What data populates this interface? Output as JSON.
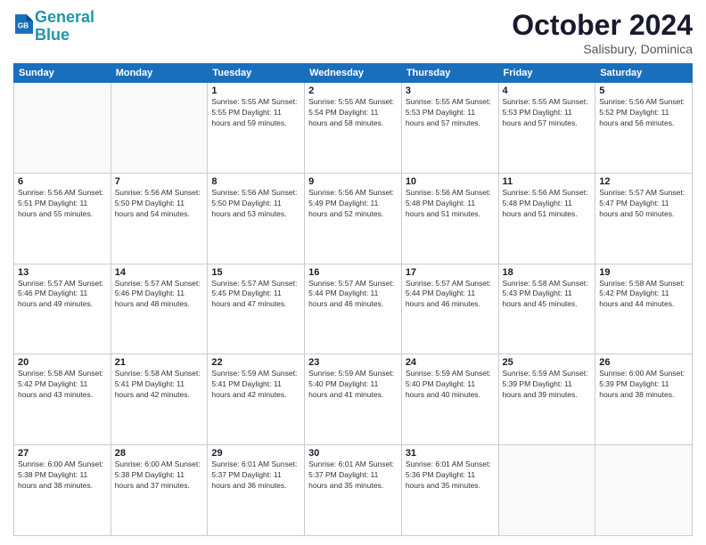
{
  "header": {
    "logo_line1": "General",
    "logo_line2": "Blue",
    "month": "October 2024",
    "location": "Salisbury, Dominica"
  },
  "days_of_week": [
    "Sunday",
    "Monday",
    "Tuesday",
    "Wednesday",
    "Thursday",
    "Friday",
    "Saturday"
  ],
  "weeks": [
    [
      {
        "day": "",
        "detail": ""
      },
      {
        "day": "",
        "detail": ""
      },
      {
        "day": "1",
        "detail": "Sunrise: 5:55 AM\nSunset: 5:55 PM\nDaylight: 11 hours and 59 minutes."
      },
      {
        "day": "2",
        "detail": "Sunrise: 5:55 AM\nSunset: 5:54 PM\nDaylight: 11 hours and 58 minutes."
      },
      {
        "day": "3",
        "detail": "Sunrise: 5:55 AM\nSunset: 5:53 PM\nDaylight: 11 hours and 57 minutes."
      },
      {
        "day": "4",
        "detail": "Sunrise: 5:55 AM\nSunset: 5:53 PM\nDaylight: 11 hours and 57 minutes."
      },
      {
        "day": "5",
        "detail": "Sunrise: 5:56 AM\nSunset: 5:52 PM\nDaylight: 11 hours and 56 minutes."
      }
    ],
    [
      {
        "day": "6",
        "detail": "Sunrise: 5:56 AM\nSunset: 5:51 PM\nDaylight: 11 hours and 55 minutes."
      },
      {
        "day": "7",
        "detail": "Sunrise: 5:56 AM\nSunset: 5:50 PM\nDaylight: 11 hours and 54 minutes."
      },
      {
        "day": "8",
        "detail": "Sunrise: 5:56 AM\nSunset: 5:50 PM\nDaylight: 11 hours and 53 minutes."
      },
      {
        "day": "9",
        "detail": "Sunrise: 5:56 AM\nSunset: 5:49 PM\nDaylight: 11 hours and 52 minutes."
      },
      {
        "day": "10",
        "detail": "Sunrise: 5:56 AM\nSunset: 5:48 PM\nDaylight: 11 hours and 51 minutes."
      },
      {
        "day": "11",
        "detail": "Sunrise: 5:56 AM\nSunset: 5:48 PM\nDaylight: 11 hours and 51 minutes."
      },
      {
        "day": "12",
        "detail": "Sunrise: 5:57 AM\nSunset: 5:47 PM\nDaylight: 11 hours and 50 minutes."
      }
    ],
    [
      {
        "day": "13",
        "detail": "Sunrise: 5:57 AM\nSunset: 5:46 PM\nDaylight: 11 hours and 49 minutes."
      },
      {
        "day": "14",
        "detail": "Sunrise: 5:57 AM\nSunset: 5:46 PM\nDaylight: 11 hours and 48 minutes."
      },
      {
        "day": "15",
        "detail": "Sunrise: 5:57 AM\nSunset: 5:45 PM\nDaylight: 11 hours and 47 minutes."
      },
      {
        "day": "16",
        "detail": "Sunrise: 5:57 AM\nSunset: 5:44 PM\nDaylight: 11 hours and 46 minutes."
      },
      {
        "day": "17",
        "detail": "Sunrise: 5:57 AM\nSunset: 5:44 PM\nDaylight: 11 hours and 46 minutes."
      },
      {
        "day": "18",
        "detail": "Sunrise: 5:58 AM\nSunset: 5:43 PM\nDaylight: 11 hours and 45 minutes."
      },
      {
        "day": "19",
        "detail": "Sunrise: 5:58 AM\nSunset: 5:42 PM\nDaylight: 11 hours and 44 minutes."
      }
    ],
    [
      {
        "day": "20",
        "detail": "Sunrise: 5:58 AM\nSunset: 5:42 PM\nDaylight: 11 hours and 43 minutes."
      },
      {
        "day": "21",
        "detail": "Sunrise: 5:58 AM\nSunset: 5:41 PM\nDaylight: 11 hours and 42 minutes."
      },
      {
        "day": "22",
        "detail": "Sunrise: 5:59 AM\nSunset: 5:41 PM\nDaylight: 11 hours and 42 minutes."
      },
      {
        "day": "23",
        "detail": "Sunrise: 5:59 AM\nSunset: 5:40 PM\nDaylight: 11 hours and 41 minutes."
      },
      {
        "day": "24",
        "detail": "Sunrise: 5:59 AM\nSunset: 5:40 PM\nDaylight: 11 hours and 40 minutes."
      },
      {
        "day": "25",
        "detail": "Sunrise: 5:59 AM\nSunset: 5:39 PM\nDaylight: 11 hours and 39 minutes."
      },
      {
        "day": "26",
        "detail": "Sunrise: 6:00 AM\nSunset: 5:39 PM\nDaylight: 11 hours and 38 minutes."
      }
    ],
    [
      {
        "day": "27",
        "detail": "Sunrise: 6:00 AM\nSunset: 5:38 PM\nDaylight: 11 hours and 38 minutes."
      },
      {
        "day": "28",
        "detail": "Sunrise: 6:00 AM\nSunset: 5:38 PM\nDaylight: 11 hours and 37 minutes."
      },
      {
        "day": "29",
        "detail": "Sunrise: 6:01 AM\nSunset: 5:37 PM\nDaylight: 11 hours and 36 minutes."
      },
      {
        "day": "30",
        "detail": "Sunrise: 6:01 AM\nSunset: 5:37 PM\nDaylight: 11 hours and 35 minutes."
      },
      {
        "day": "31",
        "detail": "Sunrise: 6:01 AM\nSunset: 5:36 PM\nDaylight: 11 hours and 35 minutes."
      },
      {
        "day": "",
        "detail": ""
      },
      {
        "day": "",
        "detail": ""
      }
    ]
  ]
}
